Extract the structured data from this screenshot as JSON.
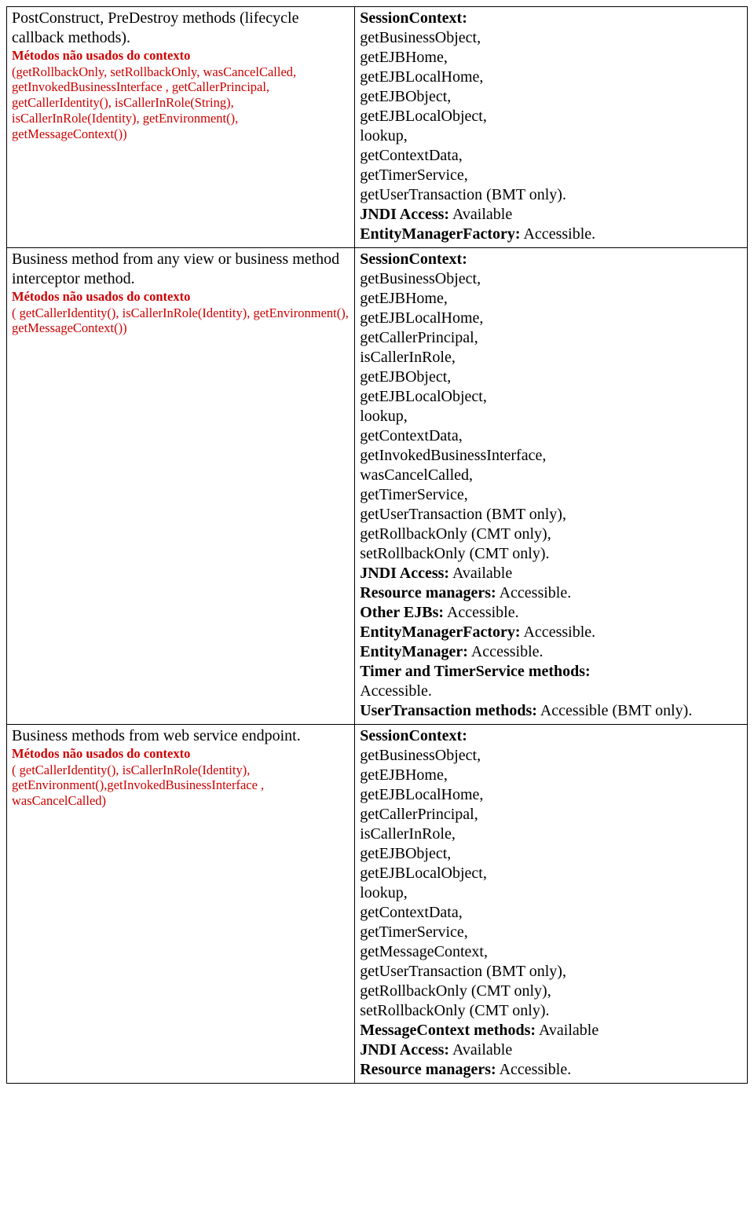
{
  "rows": [
    {
      "left": {
        "main": "PostConstruct, PreDestroy methods (lifecycle callback methods).",
        "redTitle": "Métodos não usados do contexto",
        "redBody": "(getRollbackOnly, setRollbackOnly, wasCancelCalled, getInvokedBusinessInterface , getCallerPrincipal, getCallerIdentity(), isCallerInRole(String), isCallerInRole(Identity),   getEnvironment(), getMessageContext())"
      },
      "right": [
        {
          "bold": "SessionContext:",
          "rest": ""
        },
        {
          "bold": "",
          "rest": "getBusinessObject,"
        },
        {
          "bold": "",
          "rest": "getEJBHome,"
        },
        {
          "bold": "",
          "rest": "getEJBLocalHome,"
        },
        {
          "bold": "",
          "rest": "getEJBObject,"
        },
        {
          "bold": "",
          "rest": "getEJBLocalObject,"
        },
        {
          "bold": "",
          "rest": "lookup,"
        },
        {
          "bold": "",
          "rest": "getContextData,"
        },
        {
          "bold": "",
          "rest": "getTimerService,"
        },
        {
          "bold": "",
          "rest": "getUserTransaction (BMT only)."
        },
        {
          "bold": "JNDI Access:",
          "rest": " Available"
        },
        {
          "bold": "EntityManagerFactory:",
          "rest": " Accessible."
        }
      ]
    },
    {
      "left": {
        "main": "Business method from any view or business method interceptor method.",
        "redTitle": "Métodos não usados do contexto",
        "redBody": "( getCallerIdentity(), isCallerInRole(Identity), getEnvironment(), getMessageContext())"
      },
      "right": [
        {
          "bold": "SessionContext:",
          "rest": ""
        },
        {
          "bold": "",
          "rest": "getBusinessObject,"
        },
        {
          "bold": "",
          "rest": "getEJBHome,"
        },
        {
          "bold": "",
          "rest": "getEJBLocalHome,"
        },
        {
          "bold": "",
          "rest": "getCallerPrincipal,"
        },
        {
          "bold": "",
          "rest": "isCallerInRole,"
        },
        {
          "bold": "",
          "rest": "getEJBObject,"
        },
        {
          "bold": "",
          "rest": "getEJBLocalObject,"
        },
        {
          "bold": "",
          "rest": "lookup,"
        },
        {
          "bold": "",
          "rest": "getContextData,"
        },
        {
          "bold": "",
          "rest": "getInvokedBusinessInterface,"
        },
        {
          "bold": "",
          "rest": "wasCancelCalled,"
        },
        {
          "bold": "",
          "rest": "getTimerService,"
        },
        {
          "bold": "",
          "rest": "getUserTransaction (BMT only),"
        },
        {
          "bold": "",
          "rest": "getRollbackOnly (CMT only),"
        },
        {
          "bold": "",
          "rest": "setRollbackOnly (CMT only)."
        },
        {
          "bold": "JNDI Access:",
          "rest": " Available"
        },
        {
          "bold": "Resource managers:",
          "rest": " Accessible."
        },
        {
          "bold": "Other EJBs:",
          "rest": " Accessible."
        },
        {
          "bold": "EntityManagerFactory:",
          "rest": " Accessible."
        },
        {
          "bold": "EntityManager:",
          "rest": " Accessible."
        },
        {
          "bold": "Timer and TimerService methods:",
          "rest": " Accessible.",
          "break": true
        },
        {
          "bold": "UserTransaction methods:",
          "rest": " Accessible (BMT only).",
          "break": false
        }
      ]
    },
    {
      "left": {
        "main": "Business methods from web service endpoint.",
        "redTitle": "Métodos não usados do contexto",
        "redBody": "( getCallerIdentity(), isCallerInRole(Identity), getEnvironment(),getInvokedBusinessInterface , wasCancelCalled)"
      },
      "right": [
        {
          "bold": "SessionContext:",
          "rest": ""
        },
        {
          "bold": "",
          "rest": "getBusinessObject,"
        },
        {
          "bold": "",
          "rest": "getEJBHome,"
        },
        {
          "bold": "",
          "rest": "getEJBLocalHome,"
        },
        {
          "bold": "",
          "rest": "getCallerPrincipal,"
        },
        {
          "bold": "",
          "rest": "isCallerInRole,"
        },
        {
          "bold": "",
          "rest": "getEJBObject,"
        },
        {
          "bold": "",
          "rest": "getEJBLocalObject,"
        },
        {
          "bold": "",
          "rest": "lookup,"
        },
        {
          "bold": "",
          "rest": "getContextData,"
        },
        {
          "bold": "",
          "rest": "getTimerService,"
        },
        {
          "bold": "",
          "rest": "getMessageContext,"
        },
        {
          "bold": "",
          "rest": "getUserTransaction (BMT only),"
        },
        {
          "bold": "",
          "rest": "getRollbackOnly (CMT only),"
        },
        {
          "bold": "",
          "rest": "setRollbackOnly (CMT only)."
        },
        {
          "bold": "MessageContext methods:",
          "rest": " Available"
        },
        {
          "bold": "JNDI Access:",
          "rest": " Available"
        },
        {
          "bold": "Resource managers:",
          "rest": " Accessible."
        }
      ]
    }
  ]
}
